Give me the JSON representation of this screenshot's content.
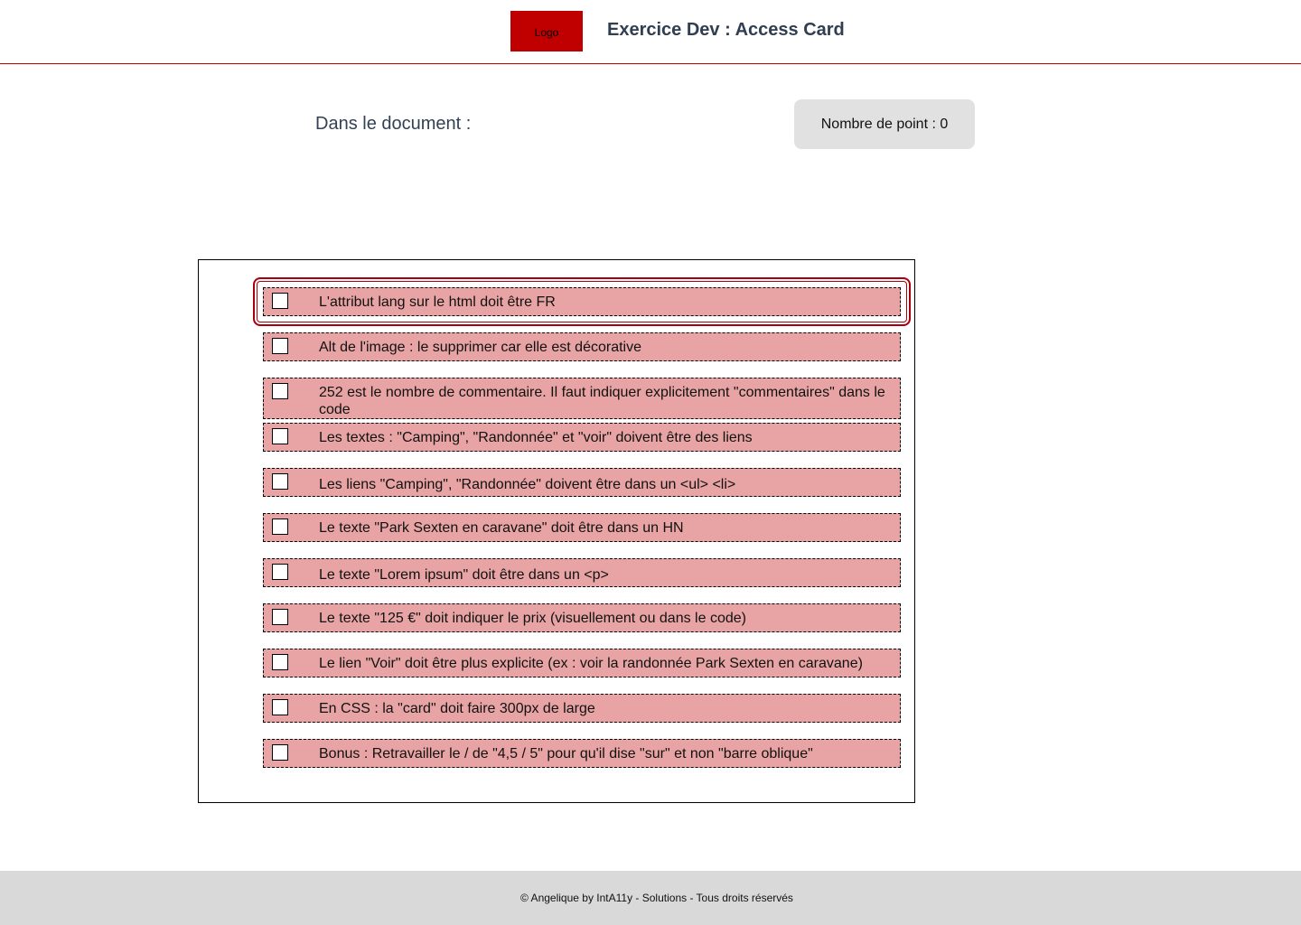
{
  "header": {
    "logo_label": "Logo",
    "title": "Exercice Dev : Access Card"
  },
  "main": {
    "document_label": "Dans le document :",
    "score_label": "Nombre de point : 0"
  },
  "checklist": {
    "items": [
      {
        "label": "L'attribut lang sur le html doit être FR",
        "checked": false,
        "focused": true
      },
      {
        "label": "Alt de l'image : le supprimer car elle est décorative",
        "checked": false
      },
      {
        "label": "252 est le nombre de commentaire. Il faut indiquer explicitement \"commentaires\" dans le code",
        "checked": false
      },
      {
        "label": "Les textes : \"Camping\", \"Randonnée\" et \"voir\" doivent être des liens",
        "checked": false
      },
      {
        "label": "Les liens \"Camping\", \"Randonnée\" doivent être dans un <ul> <li>",
        "checked": false
      },
      {
        "label": "Le texte \"Park Sexten en caravane\" doit être dans un HN",
        "checked": false
      },
      {
        "label": "Le texte \"Lorem ipsum\" doit être dans un <p>",
        "checked": false
      },
      {
        "label": "Le texte \"125 €\" doit indiquer le prix (visuellement ou dans le code)",
        "checked": false
      },
      {
        "label": "Le lien \"Voir\" doit être plus explicite (ex : voir la randonnée Park Sexten en caravane)",
        "checked": false
      },
      {
        "label": "En CSS : la \"card\" doit faire 300px de large",
        "checked": false
      },
      {
        "label": "Bonus : Retravailler le / de \"4,5 / 5\" pour qu'il dise \"sur\" et non \"barre oblique\"",
        "checked": false
      }
    ]
  },
  "footer": {
    "text": "© Angelique by IntA11y - Solutions - Tous droits réservés"
  },
  "colors": {
    "brand_red": "#c00000",
    "item_background": "#e8a4a4",
    "focus_ring": "#a8000c",
    "score_background": "#e1e1e1",
    "footer_background": "#d9d9d9"
  }
}
